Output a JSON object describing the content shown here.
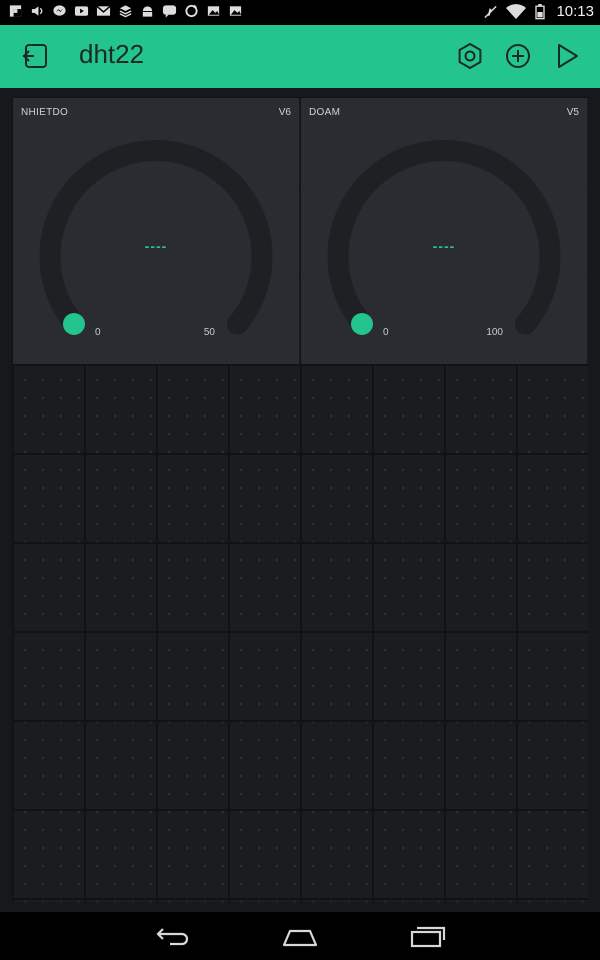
{
  "status_bar": {
    "time": "10:13",
    "left_icons": [
      "flipboard-icon",
      "volume-icon",
      "messenger-icon",
      "youtube-icon",
      "gmail-icon",
      "layers-icon",
      "android-icon",
      "chat-icon",
      "refresh-icon",
      "gallery-icon",
      "gallery-icon"
    ],
    "right_icons": [
      "mute-icon",
      "wifi-icon",
      "battery-icon"
    ]
  },
  "app_bar": {
    "title": "dht22",
    "accent": "#23c48e",
    "actions": [
      "settings-icon",
      "add-icon",
      "play-icon"
    ]
  },
  "widgets": [
    {
      "label": "NHIETDO",
      "pin": "V6",
      "value": "----",
      "min": "0",
      "max": "50"
    },
    {
      "label": "DOAM",
      "pin": "V5",
      "value": "----",
      "min": "0",
      "max": "100"
    }
  ],
  "nav_bar": {
    "buttons": [
      "back-icon",
      "home-icon",
      "recents-icon"
    ]
  }
}
